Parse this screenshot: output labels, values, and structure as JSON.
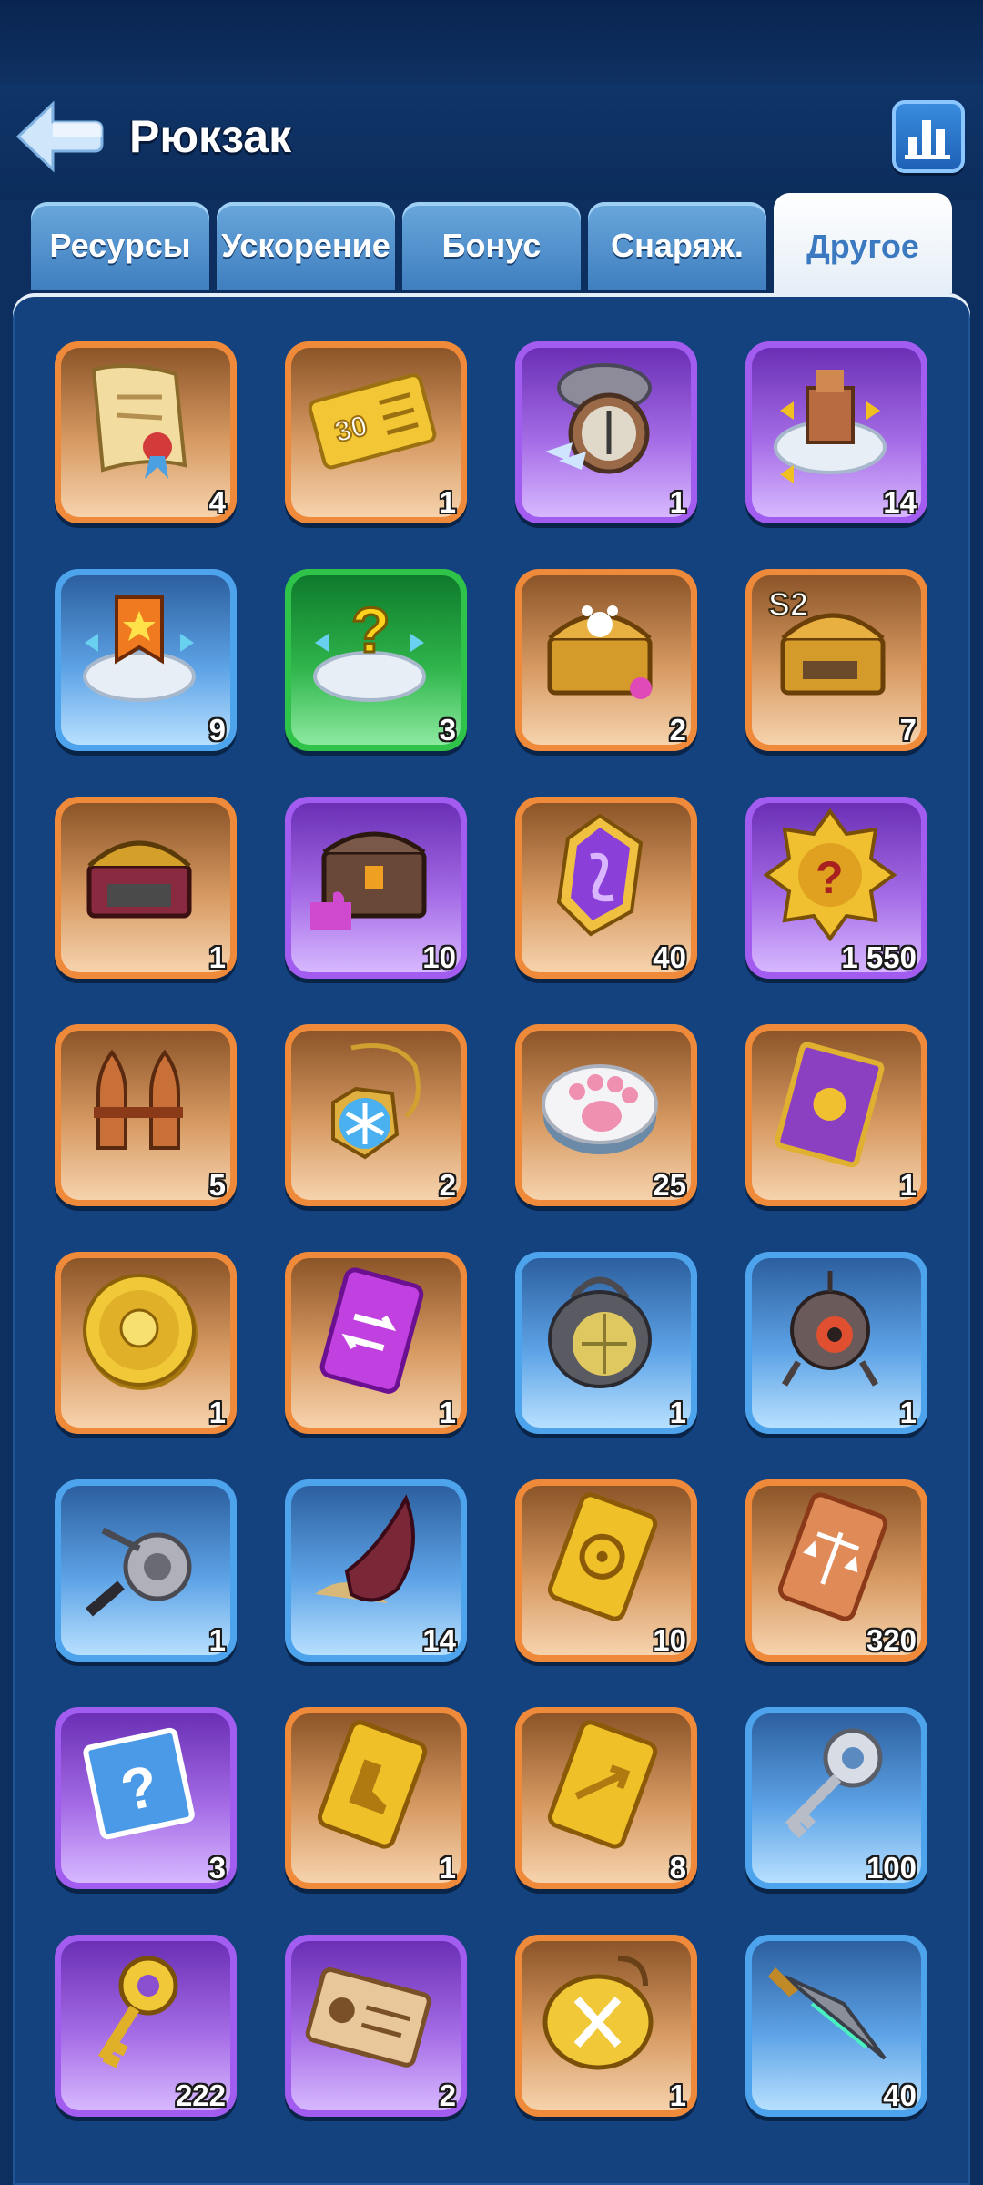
{
  "header": {
    "title": "Рюкзак"
  },
  "tabs": [
    {
      "label": "Ресурсы",
      "active": false
    },
    {
      "label": "Ускорение",
      "active": false
    },
    {
      "label": "Бонус",
      "active": false
    },
    {
      "label": "Снаряж.",
      "active": false
    },
    {
      "label": "Другое",
      "active": true
    }
  ],
  "colors": {
    "background": "#0d2f60",
    "panel": "#13427e",
    "rarity_orange": "#f08a3b",
    "rarity_purple": "#a35cf0",
    "rarity_blue": "#4da4ec",
    "rarity_green": "#2fc34a"
  },
  "items": [
    {
      "icon": "scroll-icon",
      "rarity": "orange",
      "count": "4"
    },
    {
      "icon": "ticket-30-icon",
      "rarity": "orange",
      "count": "1"
    },
    {
      "icon": "compass-icon",
      "rarity": "purple",
      "count": "1"
    },
    {
      "icon": "building-relocate-icon",
      "rarity": "purple",
      "count": "14"
    },
    {
      "icon": "banner-relocate-icon",
      "rarity": "blue",
      "count": "9"
    },
    {
      "icon": "random-relocate-icon",
      "rarity": "green",
      "count": "3"
    },
    {
      "icon": "paw-chest-icon",
      "rarity": "orange",
      "count": "2"
    },
    {
      "icon": "s2-chest-icon",
      "rarity": "orange",
      "count": "7"
    },
    {
      "icon": "gear-chest-icon",
      "rarity": "orange",
      "count": "1"
    },
    {
      "icon": "puzzle-chest-icon",
      "rarity": "purple",
      "count": "10"
    },
    {
      "icon": "rune-stone-icon",
      "rarity": "orange",
      "count": "40"
    },
    {
      "icon": "mystery-badge-icon",
      "rarity": "purple",
      "count": "1 550"
    },
    {
      "icon": "rockets-icon",
      "rarity": "orange",
      "count": "5"
    },
    {
      "icon": "snowflake-amulet-icon",
      "rarity": "orange",
      "count": "2"
    },
    {
      "icon": "paw-cookie-icon",
      "rarity": "orange",
      "count": "25"
    },
    {
      "icon": "card-icon",
      "rarity": "orange",
      "count": "1"
    },
    {
      "icon": "hero-coin-icon",
      "rarity": "orange",
      "count": "1"
    },
    {
      "icon": "exchange-ticket-icon",
      "rarity": "orange",
      "count": "1"
    },
    {
      "icon": "lantern-icon",
      "rarity": "blue",
      "count": "1"
    },
    {
      "icon": "robot-drone-icon",
      "rarity": "blue",
      "count": "1"
    },
    {
      "icon": "fishing-reel-icon",
      "rarity": "blue",
      "count": "1"
    },
    {
      "icon": "horn-icon",
      "rarity": "blue",
      "count": "14"
    },
    {
      "icon": "target-ticket-icon",
      "rarity": "orange",
      "count": "10"
    },
    {
      "icon": "scales-ticket-icon",
      "rarity": "orange",
      "count": "320"
    },
    {
      "icon": "mystery-map-icon",
      "rarity": "purple",
      "count": "3"
    },
    {
      "icon": "boot-ticket-icon",
      "rarity": "orange",
      "count": "1"
    },
    {
      "icon": "arrow-ticket-icon",
      "rarity": "orange",
      "count": "8"
    },
    {
      "icon": "silver-key-icon",
      "rarity": "blue",
      "count": "100"
    },
    {
      "icon": "gold-key-icon",
      "rarity": "purple",
      "count": "222"
    },
    {
      "icon": "id-card-icon",
      "rarity": "purple",
      "count": "2"
    },
    {
      "icon": "sword-medal-icon",
      "rarity": "orange",
      "count": "1"
    },
    {
      "icon": "spear-tip-icon",
      "rarity": "blue",
      "count": "40"
    }
  ]
}
